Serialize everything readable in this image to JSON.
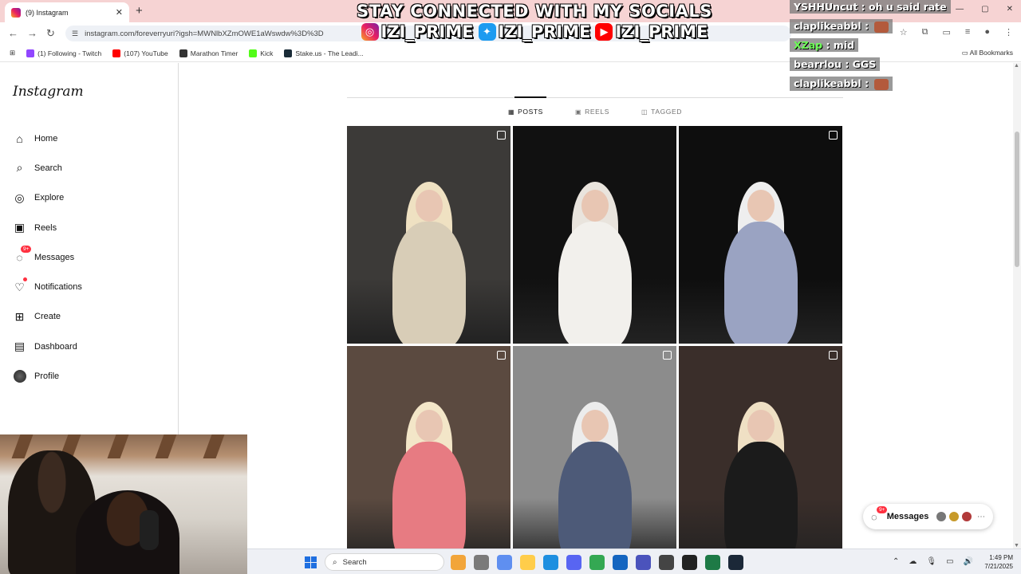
{
  "browser": {
    "tab_title": "(9) Instagram",
    "url": "instagram.com/foreverryuri?igsh=MWNlbXZmOWE1aWswdw%3D%3D",
    "bookmarks": [
      {
        "label": "(1) Following - Twitch",
        "color": "#9146ff"
      },
      {
        "label": "(107) YouTube",
        "color": "#ff0000"
      },
      {
        "label": "Marathon Timer",
        "color": "#333333"
      },
      {
        "label": "Kick",
        "color": "#53fc18"
      },
      {
        "label": "Stake.us - The Leadi...",
        "color": "#1a2c38"
      }
    ],
    "all_bookmarks": "All Bookmarks"
  },
  "overlay": {
    "headline": "STAY CONNECTED WITH MY SOCIALS",
    "socials": [
      {
        "platform": "instagram-icon",
        "handle": "IZI_PRIME"
      },
      {
        "platform": "twitter-icon",
        "handle": "IZI_PRIME"
      },
      {
        "platform": "youtube-icon",
        "handle": "IZI_PRIME"
      }
    ]
  },
  "chat": [
    {
      "user": "YSHHUncut",
      "sep": " : ",
      "text": "oh u said rate",
      "color": "#ffffff",
      "emote": false
    },
    {
      "user": "claplikeabbl",
      "sep": " : ",
      "text": "",
      "color": "#ffffff",
      "emote": true
    },
    {
      "user": "XZap",
      "sep": " : ",
      "text": "mid",
      "color": "#6fff59",
      "emote": false
    },
    {
      "user": "bearrlou",
      "sep": " : ",
      "text": "GGS",
      "color": "#ffffff",
      "emote": false
    },
    {
      "user": "claplikeabbl",
      "sep": " : ",
      "text": "",
      "color": "#ffffff",
      "emote": true
    }
  ],
  "instagram": {
    "logo": "Instagram",
    "nav": [
      {
        "key": "home",
        "label": "Home",
        "icon": "home-icon",
        "glyph": "⌂"
      },
      {
        "key": "search",
        "label": "Search",
        "icon": "search-icon",
        "glyph": "⌕"
      },
      {
        "key": "explore",
        "label": "Explore",
        "icon": "compass-icon",
        "glyph": "◎"
      },
      {
        "key": "reels",
        "label": "Reels",
        "icon": "reels-icon",
        "glyph": "▣"
      },
      {
        "key": "messages",
        "label": "Messages",
        "icon": "messenger-icon",
        "glyph": "◌",
        "badge": "9+"
      },
      {
        "key": "notifications",
        "label": "Notifications",
        "icon": "heart-icon",
        "glyph": "♡",
        "dot": true
      },
      {
        "key": "create",
        "label": "Create",
        "icon": "plus-square-icon",
        "glyph": "⊞"
      },
      {
        "key": "dashboard",
        "label": "Dashboard",
        "icon": "dashboard-icon",
        "glyph": "▤"
      },
      {
        "key": "profile",
        "label": "Profile",
        "icon": "avatar",
        "glyph": ""
      }
    ],
    "profile_tabs": [
      {
        "label": "POSTS",
        "icon": "grid-icon",
        "glyph": "▦",
        "active": true
      },
      {
        "label": "REELS",
        "icon": "reels-icon",
        "glyph": "▣",
        "active": false
      },
      {
        "label": "TAGGED",
        "icon": "tag-icon",
        "glyph": "◫",
        "active": false
      }
    ],
    "posts": [
      {
        "type": "reel-icon",
        "bg": "#3c3a38",
        "dress": "#d8cdb7",
        "hair": "#efe1c2"
      },
      {
        "type": "none",
        "bg": "#111111",
        "dress": "#f2f0ec",
        "hair": "#e9e4dd"
      },
      {
        "type": "carousel-icon",
        "bg": "#0e0e0e",
        "dress": "#9aa3c2",
        "hair": "#eeeeee"
      },
      {
        "type": "carousel-icon",
        "bg": "#5b4a40",
        "dress": "#e77b82",
        "hair": "#f3e6c8"
      },
      {
        "type": "carousel-icon",
        "bg": "#8c8c8c",
        "dress": "#4d5a78",
        "hair": "#ececec"
      },
      {
        "type": "carousel-icon",
        "bg": "#3a2e2a",
        "dress": "#1b1b1b",
        "hair": "#efe0c4"
      }
    ],
    "messages_pill": {
      "label": "Messages",
      "badge": "9+"
    }
  },
  "taskbar": {
    "search_label": "Search",
    "time": "1:49 PM",
    "date": "7/21/2025",
    "apps": [
      "#f2a53a",
      "#7a7a7a",
      "#5f8ff0",
      "#ffcd4a",
      "#1e8fe0",
      "#5865f2",
      "#34a853",
      "#1565c0",
      "#4b53bc",
      "#444444",
      "#222222",
      "#1e7a46",
      "#1b2838"
    ]
  }
}
